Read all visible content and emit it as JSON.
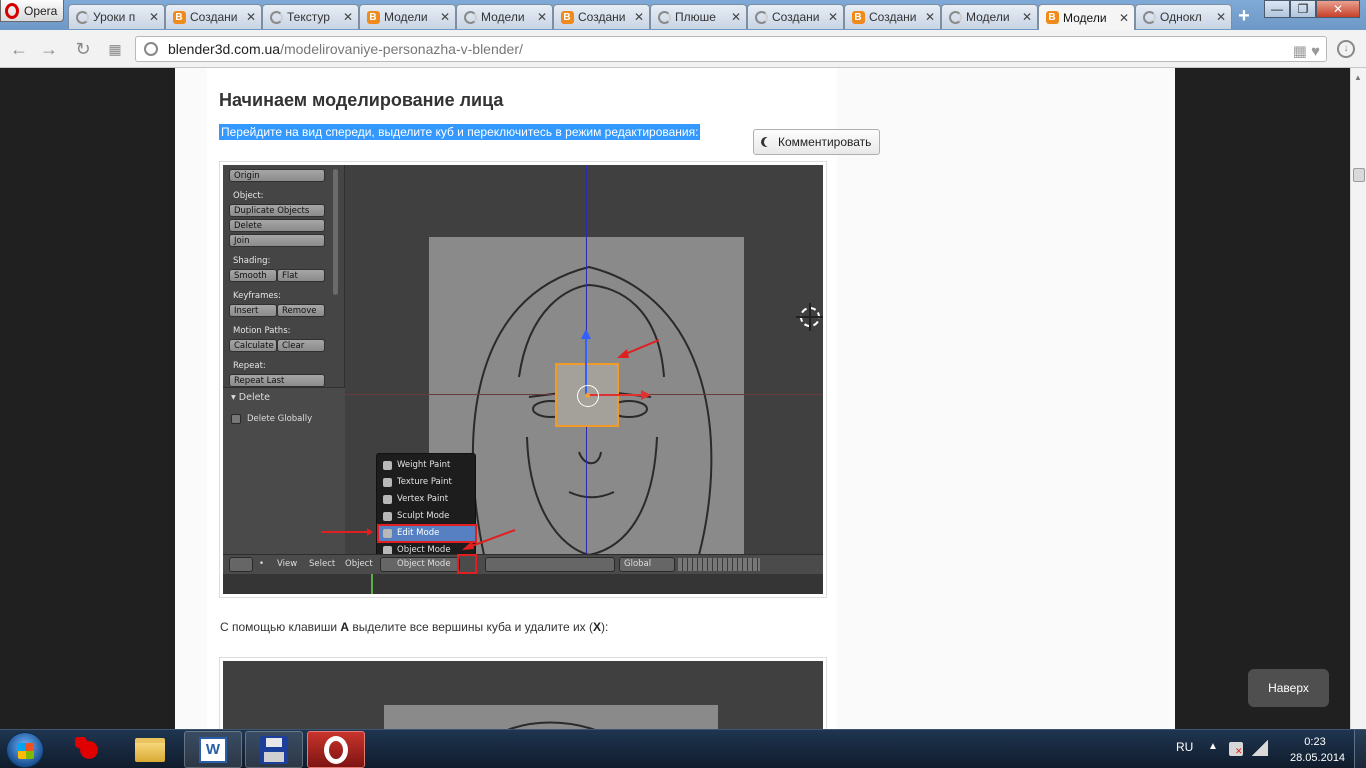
{
  "browser": {
    "menu_label": "Opera",
    "tabs": [
      {
        "label": "Уроки п",
        "icon": "loading-icon",
        "active": false
      },
      {
        "label": "Создани",
        "icon": "blender-icon",
        "active": false
      },
      {
        "label": "Текстур",
        "icon": "loading-icon",
        "active": false
      },
      {
        "label": "Модели",
        "icon": "blender-icon",
        "active": false
      },
      {
        "label": "Модели",
        "icon": "loading-icon",
        "active": false
      },
      {
        "label": "Создани",
        "icon": "blender-icon",
        "active": false
      },
      {
        "label": "Плюше",
        "icon": "loading-icon",
        "active": false
      },
      {
        "label": "Создани",
        "icon": "loading-icon",
        "active": false
      },
      {
        "label": "Создани",
        "icon": "blender-icon",
        "active": false
      },
      {
        "label": "Модели",
        "icon": "loading-icon",
        "active": false
      },
      {
        "label": "Модели",
        "icon": "blender-icon",
        "active": true
      },
      {
        "label": "Однокл",
        "icon": "loading-icon",
        "active": false
      }
    ],
    "url_host": "blender3d.com.ua",
    "url_path": "/modelirovaniye-personazha-v-blender/"
  },
  "article": {
    "heading": "Начинаем моделирование лица",
    "selected_text": "Перейдите на вид спереди, выделите куб и переключитесь в режим редактирования:",
    "comment_button": "Комментировать",
    "paragraph_prefix": "С помощью клавиши ",
    "paragraph_key1": "A",
    "paragraph_middle": " выделите все вершины куба и удалите их (",
    "paragraph_key2": "X",
    "paragraph_suffix": "):",
    "back_to_top": "Наверх"
  },
  "blender": {
    "tool_buttons": {
      "origin": "Origin",
      "object_label": "Object:",
      "duplicate": "Duplicate Objects",
      "delete": "Delete",
      "join": "Join",
      "shading_label": "Shading:",
      "smooth": "Smooth",
      "flat": "Flat",
      "keyframes_label": "Keyframes:",
      "insert": "Insert",
      "remove": "Remove",
      "motion_paths_label": "Motion Paths:",
      "calculate": "Calculate",
      "clear": "Clear",
      "repeat_label": "Repeat:",
      "repeat_last": "Repeat Last"
    },
    "operator_title": "▾ Delete",
    "delete_globally": "Delete Globally",
    "mode_menu": [
      {
        "label": "Weight Paint",
        "selected": false
      },
      {
        "label": "Texture Paint",
        "selected": false
      },
      {
        "label": "Vertex Paint",
        "selected": false
      },
      {
        "label": "Sculpt Mode",
        "selected": false
      },
      {
        "label": "Edit Mode",
        "selected": true
      },
      {
        "label": "Object Mode",
        "selected": false
      }
    ],
    "header_view": "View",
    "header_select": "Select",
    "header_object": "Object",
    "header_mode": "Object Mode",
    "header_orientation": "Global"
  },
  "taskbar": {
    "language": "RU",
    "time": "0:23",
    "date": "28.05.2014"
  }
}
